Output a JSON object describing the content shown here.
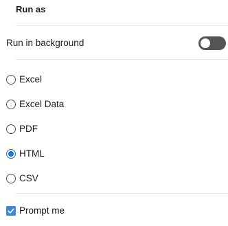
{
  "run_as": {
    "title": "Run as",
    "background": {
      "label": "Run in background",
      "enabled": false
    },
    "formats": [
      {
        "label": "Excel",
        "selected": false
      },
      {
        "label": "Excel Data",
        "selected": false
      },
      {
        "label": "PDF",
        "selected": false
      },
      {
        "label": "HTML",
        "selected": true
      },
      {
        "label": "CSV",
        "selected": false
      }
    ],
    "prompt": {
      "label": "Prompt me",
      "checked": true
    }
  },
  "colors": {
    "accent": "#1f70c1",
    "checkbox": "#3f86d4",
    "toggle_off": "#555555",
    "divider": "#e4e4e4"
  }
}
